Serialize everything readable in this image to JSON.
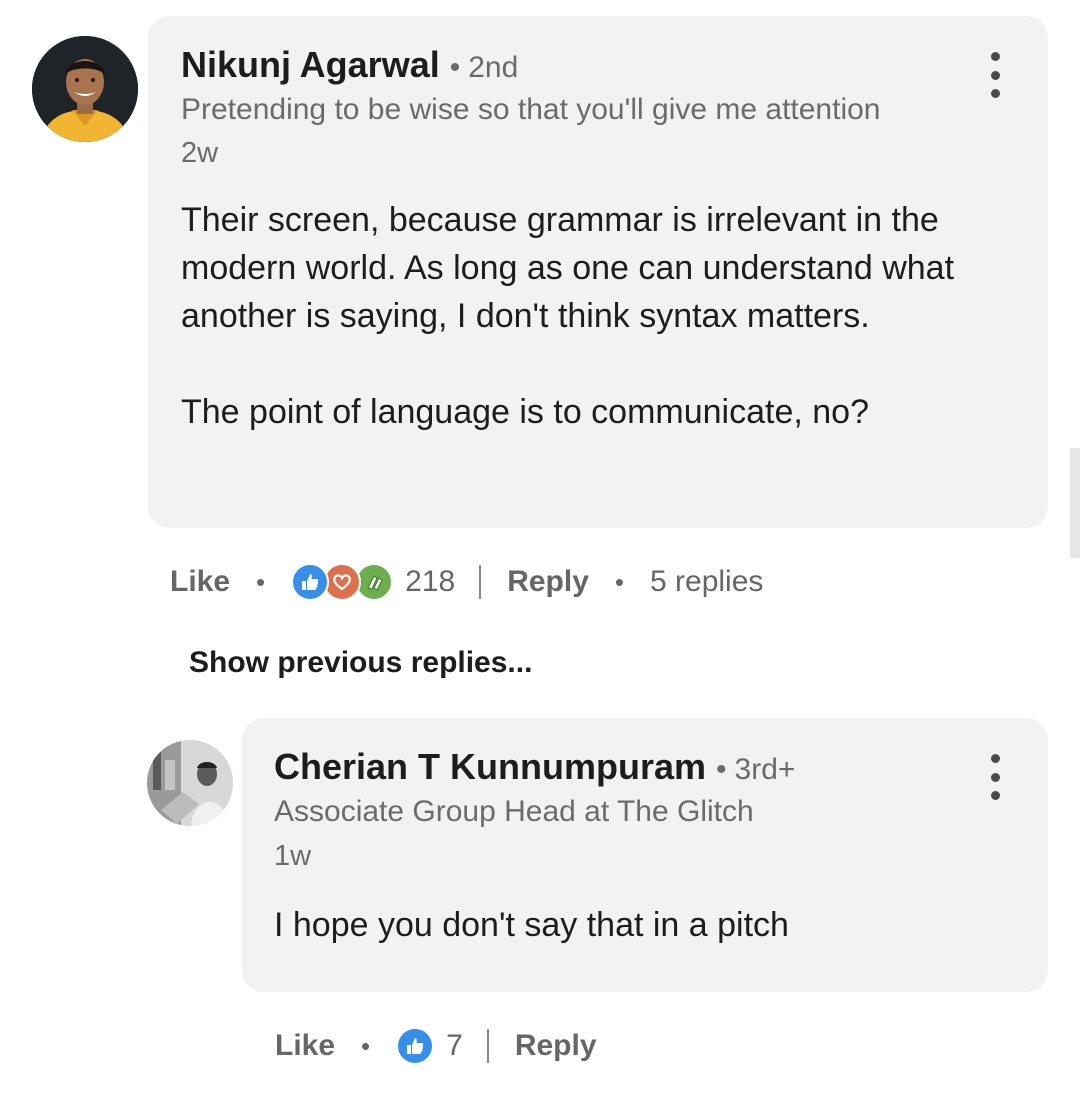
{
  "comment": {
    "author": "Nikunj Agarwal",
    "degree": "2nd",
    "degree_separator": "•",
    "headline": "Pretending to be wise so that you'll give me attention",
    "time": "2w",
    "paragraphs": [
      "Their screen, because grammar is irrelevant in the modern world. As long as one can understand what another is saying, I don't think syntax matters.",
      "The point of language is to communicate, no?"
    ],
    "like_label": "Like",
    "separator": "•",
    "reactions": [
      "like-icon",
      "love-icon",
      "celebrate-icon"
    ],
    "reaction_count": "218",
    "reply_label": "Reply",
    "replies_count": "5 replies"
  },
  "show_previous_label": "Show previous replies...",
  "reply": {
    "author": "Cherian T Kunnumpuram",
    "degree": "3rd+",
    "degree_separator": "•",
    "headline": "Associate Group Head at The Glitch",
    "time": "1w",
    "text": "I hope you don't say that in a pitch",
    "like_label": "Like",
    "separator": "•",
    "reactions": [
      "like-icon"
    ],
    "reaction_count": "7",
    "reply_label": "Reply"
  },
  "colors": {
    "bubble": "#f2f2f2",
    "text": "#1d1d1d",
    "secondary": "#6b6b6b",
    "like_blue": "#378fe9",
    "love_red": "#df704d",
    "celebrate_green": "#6dae4f"
  }
}
